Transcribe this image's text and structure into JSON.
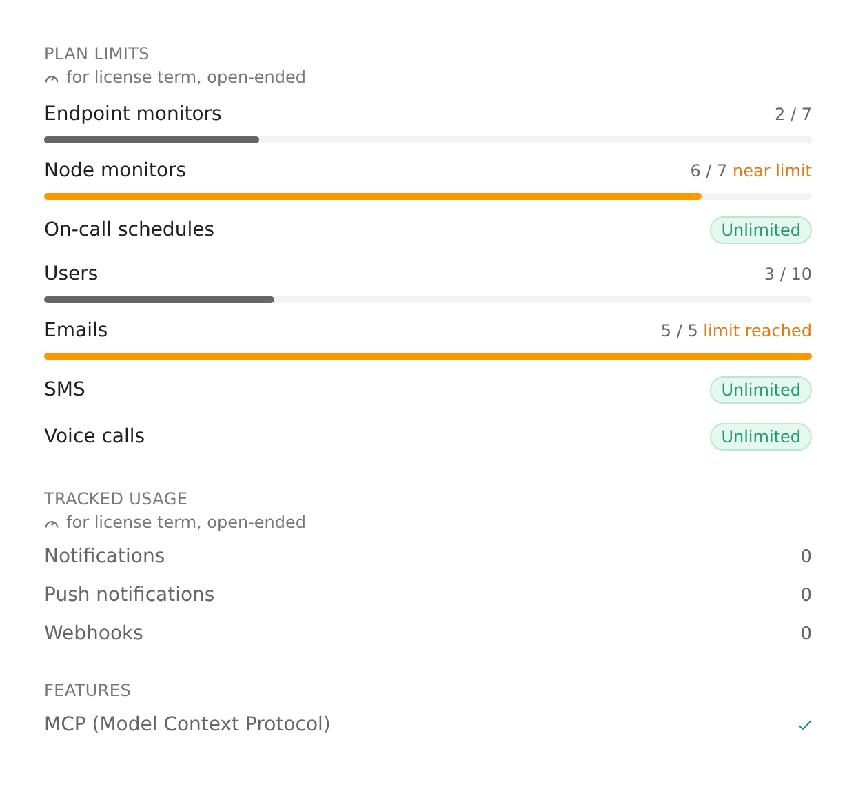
{
  "plan_limits": {
    "title": "PLAN LIMITS",
    "subtitle": "for license term, open-ended",
    "items": [
      {
        "kind": "bar",
        "label": "Endpoint monitors",
        "count": "2 / 7",
        "level": 0.28,
        "warning": false
      },
      {
        "kind": "bar",
        "label": "Node monitors",
        "count": "6 / 7",
        "note": "near limit",
        "level": 0.857,
        "warning": true
      },
      {
        "kind": "badge",
        "label": "On-call schedules",
        "badge": "Unlimited"
      },
      {
        "kind": "bar",
        "label": "Users",
        "count": "3 / 10",
        "level": 0.3,
        "warning": false
      },
      {
        "kind": "bar",
        "label": "Emails",
        "count": "5 / 5",
        "note": "limit reached",
        "level": 1,
        "warning": true
      },
      {
        "kind": "badge",
        "label": "SMS",
        "badge": "Unlimited"
      },
      {
        "kind": "badge",
        "label": "Voice calls",
        "badge": "Unlimited"
      }
    ]
  },
  "tracked_usage": {
    "title": "TRACKED USAGE",
    "subtitle": "for license term, open-ended",
    "items": [
      {
        "label": "Notifications",
        "value": "0"
      },
      {
        "label": "Push notifications",
        "value": "0"
      },
      {
        "label": "Webhooks",
        "value": "0"
      }
    ]
  },
  "features": {
    "title": "FEATURES",
    "items": [
      {
        "label": "MCP (Model Context Protocol)",
        "enabled": true
      }
    ]
  }
}
